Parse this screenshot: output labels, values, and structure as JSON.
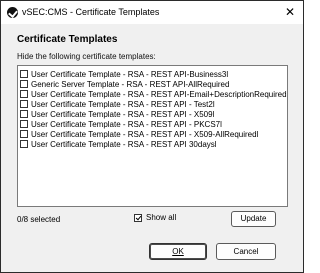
{
  "window": {
    "title": "vSEC:CMS - Certificate Templates",
    "close_glyph": "✕"
  },
  "dialog": {
    "heading": "Certificate Templates",
    "subtitle": "Hide the following certificate templates:",
    "items": [
      {
        "label": "User Certificate Template - RSA - REST API-Business3l",
        "checked": false
      },
      {
        "label": "Generic Server Template - RSA - REST API-AllRequired",
        "checked": false
      },
      {
        "label": "User Certificate Template - RSA - REST API-Email+DescriptionRequiredl",
        "checked": false
      },
      {
        "label": "User Certificate Template - RSA - REST API - Test2l",
        "checked": false
      },
      {
        "label": "User Certificate Template - RSA - REST API - X509l",
        "checked": false
      },
      {
        "label": "User Certificate Template - RSA - REST API - PKCS7l",
        "checked": false
      },
      {
        "label": "User Certificate Template - RSA - REST API - X509-AllRequiredl",
        "checked": false
      },
      {
        "label": "User Certificate Template - RSA - REST API 30daysl",
        "checked": false
      }
    ],
    "selected_count": "0/8 selected",
    "show_all_label": "Show all",
    "show_all_checked": true,
    "update_label": "Update",
    "ok_label": "OK",
    "cancel_label": "Cancel"
  }
}
